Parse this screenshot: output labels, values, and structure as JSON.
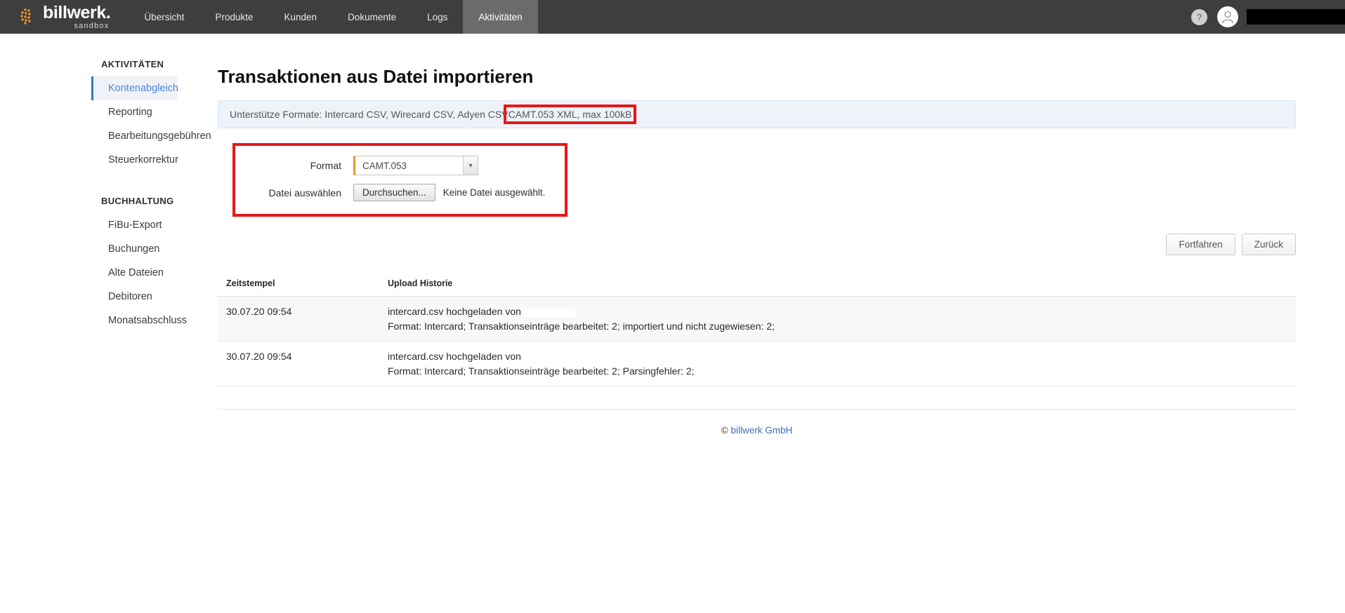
{
  "brand": {
    "name": "billwerk.",
    "sub": "sandbox",
    "logo_icon": "billwerk-dots-logo"
  },
  "topnav": {
    "items": [
      {
        "label": "Übersicht",
        "active": false
      },
      {
        "label": "Produkte",
        "active": false
      },
      {
        "label": "Kunden",
        "active": false
      },
      {
        "label": "Dokumente",
        "active": false
      },
      {
        "label": "Logs",
        "active": false
      },
      {
        "label": "Aktivitäten",
        "active": true
      }
    ],
    "help_icon": "question-mark-icon",
    "help_label": "?",
    "avatar_icon": "user-avatar-icon",
    "user_name_redacted": true
  },
  "sidebar": {
    "groups": [
      {
        "title": "AKTIVITÄTEN",
        "items": [
          {
            "label": "Kontenabgleich",
            "active": true
          },
          {
            "label": "Reporting",
            "active": false
          },
          {
            "label": "Bearbeitungsgebühren",
            "active": false
          },
          {
            "label": "Steuerkorrektur",
            "active": false
          }
        ]
      },
      {
        "title": "BUCHHALTUNG",
        "items": [
          {
            "label": "FiBu-Export",
            "active": false
          },
          {
            "label": "Buchungen",
            "active": false
          },
          {
            "label": "Alte Dateien",
            "active": false
          },
          {
            "label": "Debitoren",
            "active": false
          },
          {
            "label": "Monatsabschluss",
            "active": false
          }
        ]
      }
    ]
  },
  "main": {
    "title": "Transaktionen aus Datei importieren",
    "info_bar": {
      "text_before": "Unterstütze Formate: Intercard CSV, Wirecard CSV, Adyen CSV",
      "highlighted": "CAMT.053 XML, max 100kB"
    },
    "form": {
      "format_label": "Format",
      "format_value": "CAMT.053",
      "format_options": [
        "CAMT.053"
      ],
      "select_arrow_icon": "chevron-down-icon",
      "file_label": "Datei auswählen",
      "browse_button": "Durchsuchen...",
      "file_status": "Keine Datei ausgewählt."
    },
    "buttons": {
      "continue": "Fortfahren",
      "back": "Zurück"
    },
    "table": {
      "headers": [
        "Zeitstempel",
        "Upload Historie"
      ],
      "rows": [
        {
          "timestamp": "30.07.20 09:54",
          "line1": "intercard.csv hochgeladen von",
          "line2": "Format: Intercard; Transaktionseinträge bearbeitet: 2; importiert und nicht zugewiesen: 2;",
          "user_redacted": true
        },
        {
          "timestamp": "30.07.20 09:54",
          "line1": "intercard.csv hochgeladen von",
          "line2": "Format: Intercard; Transaktionseinträge bearbeitet: 2; Parsingfehler: 2;",
          "user_redacted": false
        }
      ]
    }
  },
  "footer": {
    "copyright_symbol": "©",
    "company": "billwerk GmbH"
  },
  "colors": {
    "nav_bg": "#3e3e3e",
    "nav_active": "#6b6b6b",
    "brand_orange": "#f0952b",
    "accent_blue": "#4a87d6",
    "highlight_red": "#e8161a",
    "info_bg": "#eef3fa"
  }
}
